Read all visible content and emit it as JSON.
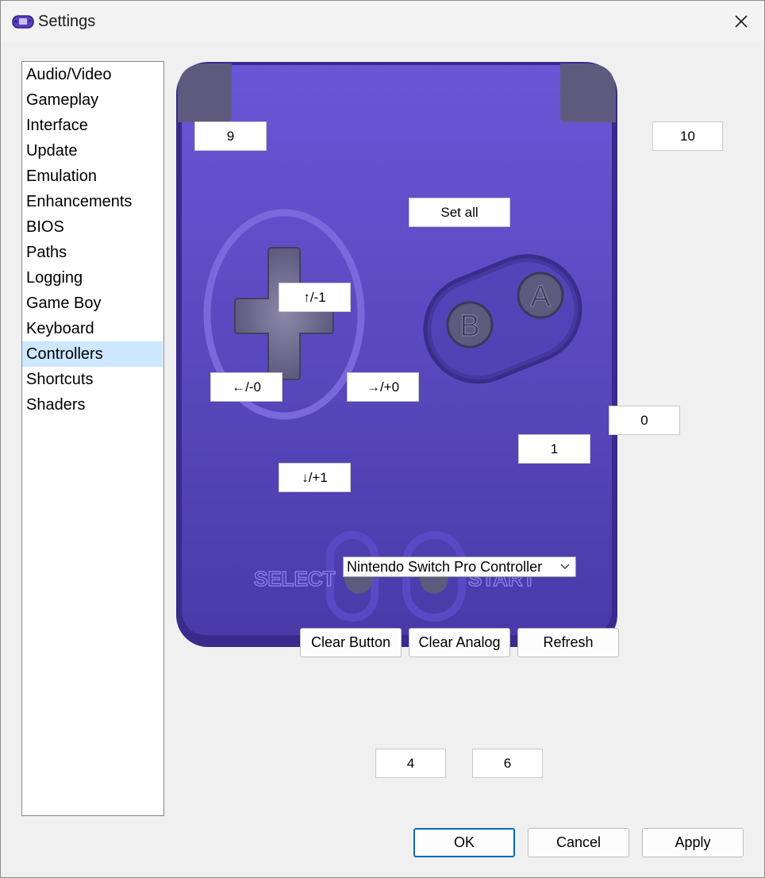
{
  "window": {
    "title": "Settings"
  },
  "icons": {
    "app": "gba-icon",
    "close": "close-icon",
    "dropdown": "chevron-down-icon"
  },
  "sidebar": {
    "items": [
      {
        "label": "Audio/Video"
      },
      {
        "label": "Gameplay"
      },
      {
        "label": "Interface"
      },
      {
        "label": "Update"
      },
      {
        "label": "Emulation"
      },
      {
        "label": "Enhancements"
      },
      {
        "label": "BIOS"
      },
      {
        "label": "Paths"
      },
      {
        "label": "Logging"
      },
      {
        "label": "Game Boy"
      },
      {
        "label": "Keyboard"
      },
      {
        "label": "Controllers"
      },
      {
        "label": "Shortcuts"
      },
      {
        "label": "Shaders"
      }
    ],
    "selected": "Controllers"
  },
  "controller": {
    "l_shoulder": "9",
    "r_shoulder": "10",
    "set_all": "Set all",
    "up": "↑/-1",
    "left": "←/-0",
    "right": "→/+0",
    "down": "↓/+1",
    "a": "0",
    "b": "1",
    "select": "4",
    "start": "6",
    "pad_labels": {
      "select": "SELECT",
      "start": "START",
      "a": "A",
      "b": "B"
    },
    "device": {
      "selected": "Nintendo Switch Pro Controller"
    },
    "clear_button": "Clear Button",
    "clear_analog": "Clear Analog",
    "refresh": "Refresh"
  },
  "footer": {
    "ok": "OK",
    "cancel": "Cancel",
    "apply": "Apply"
  },
  "colors": {
    "pad_top": "#6b56d6",
    "pad_bottom": "#4a3aa8",
    "pad_border": "#3a2a8c",
    "selection": "#cce8ff",
    "accent": "#0067c0"
  }
}
